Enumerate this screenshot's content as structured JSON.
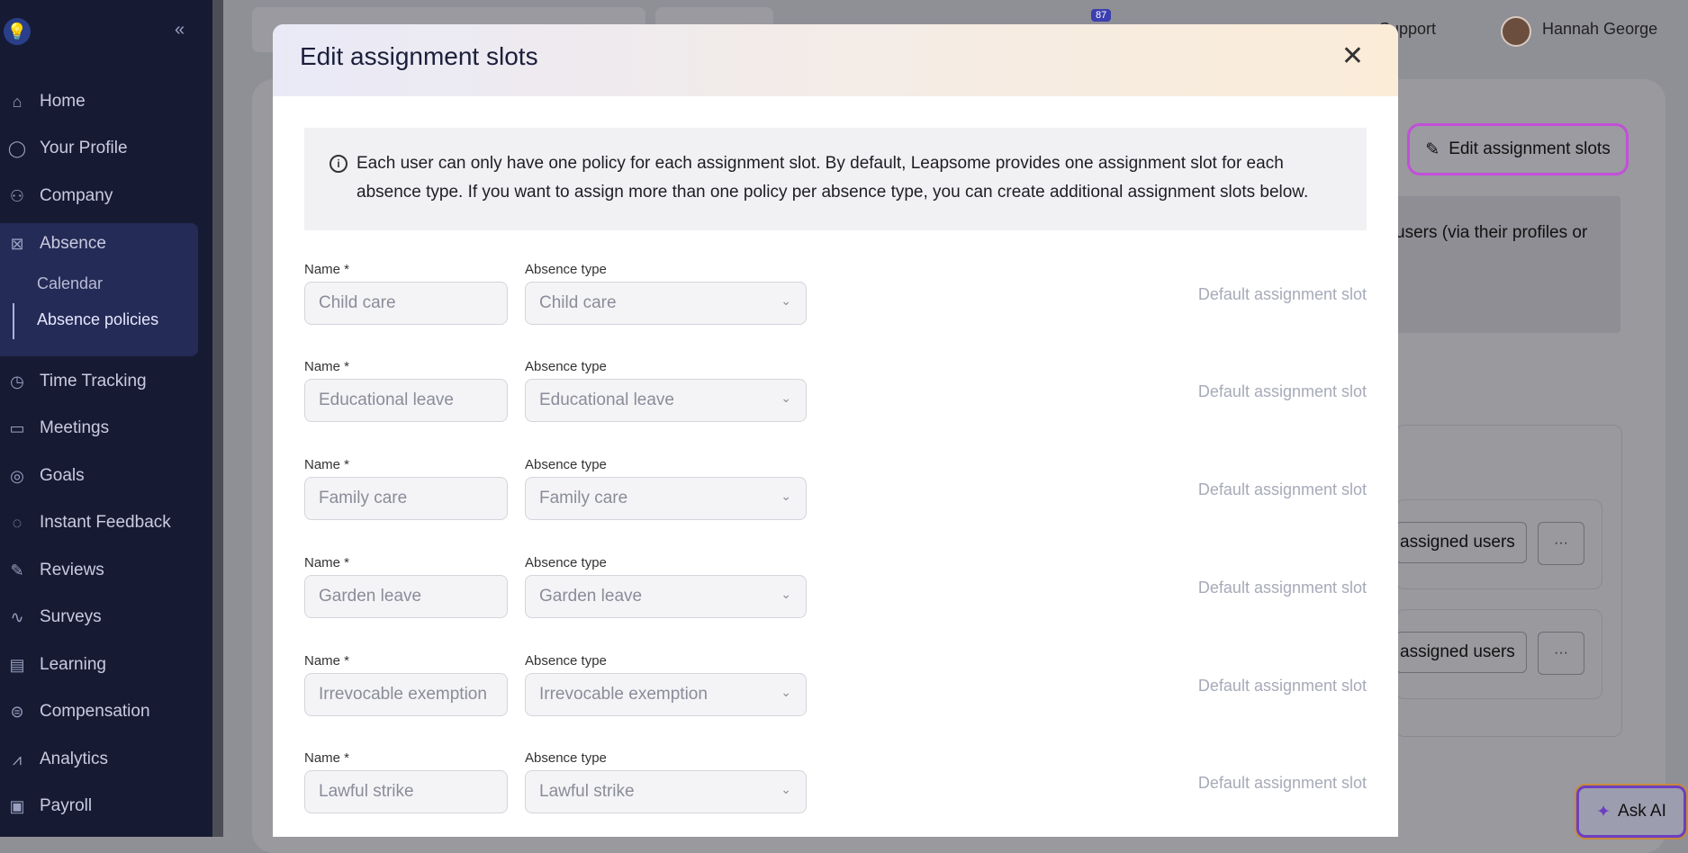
{
  "sidebar": {
    "items": [
      {
        "label": "Home",
        "icon": "home-icon"
      },
      {
        "label": "Your Profile",
        "icon": "user-icon"
      },
      {
        "label": "Company",
        "icon": "team-icon"
      },
      {
        "label": "Absence",
        "icon": "calendar-x-icon"
      },
      {
        "label": "Time Tracking",
        "icon": "clock-icon"
      },
      {
        "label": "Meetings",
        "icon": "calendar-icon"
      },
      {
        "label": "Goals",
        "icon": "target-icon"
      },
      {
        "label": "Instant Feedback",
        "icon": "chat-icon"
      },
      {
        "label": "Reviews",
        "icon": "pencil-icon"
      },
      {
        "label": "Surveys",
        "icon": "pulse-icon"
      },
      {
        "label": "Learning",
        "icon": "book-icon"
      },
      {
        "label": "Compensation",
        "icon": "coins-icon"
      },
      {
        "label": "Analytics",
        "icon": "chart-icon"
      },
      {
        "label": "Payroll",
        "icon": "money-icon"
      }
    ],
    "absence_sub": {
      "calendar": "Calendar",
      "policies": "Absence policies"
    }
  },
  "topbar": {
    "badge": "87",
    "support": "Support",
    "user_name": "Hannah George"
  },
  "background": {
    "edit_slots_button": "Edit assignment slots",
    "info_fragment": "users (via their profiles or",
    "assigned_users_label": "assigned users",
    "more_label": "···",
    "ask_ai": "Ask AI"
  },
  "modal": {
    "title": "Edit assignment slots",
    "info": "Each user can only have one policy for each assignment slot. By default, Leapsome provides one assignment slot for each absence type. If you want to assign more than one policy per absence type, you can create additional assignment slots below.",
    "name_label": "Name *",
    "type_label": "Absence type",
    "default_label": "Default assignment slot",
    "slots": [
      {
        "name": "Child care",
        "type": "Child care"
      },
      {
        "name": "Educational leave",
        "type": "Educational leave"
      },
      {
        "name": "Family care",
        "type": "Family care"
      },
      {
        "name": "Garden leave",
        "type": "Garden leave"
      },
      {
        "name": "Irrevocable exemption",
        "type": "Irrevocable exemption"
      },
      {
        "name": "Lawful strike",
        "type": "Lawful strike"
      }
    ]
  }
}
